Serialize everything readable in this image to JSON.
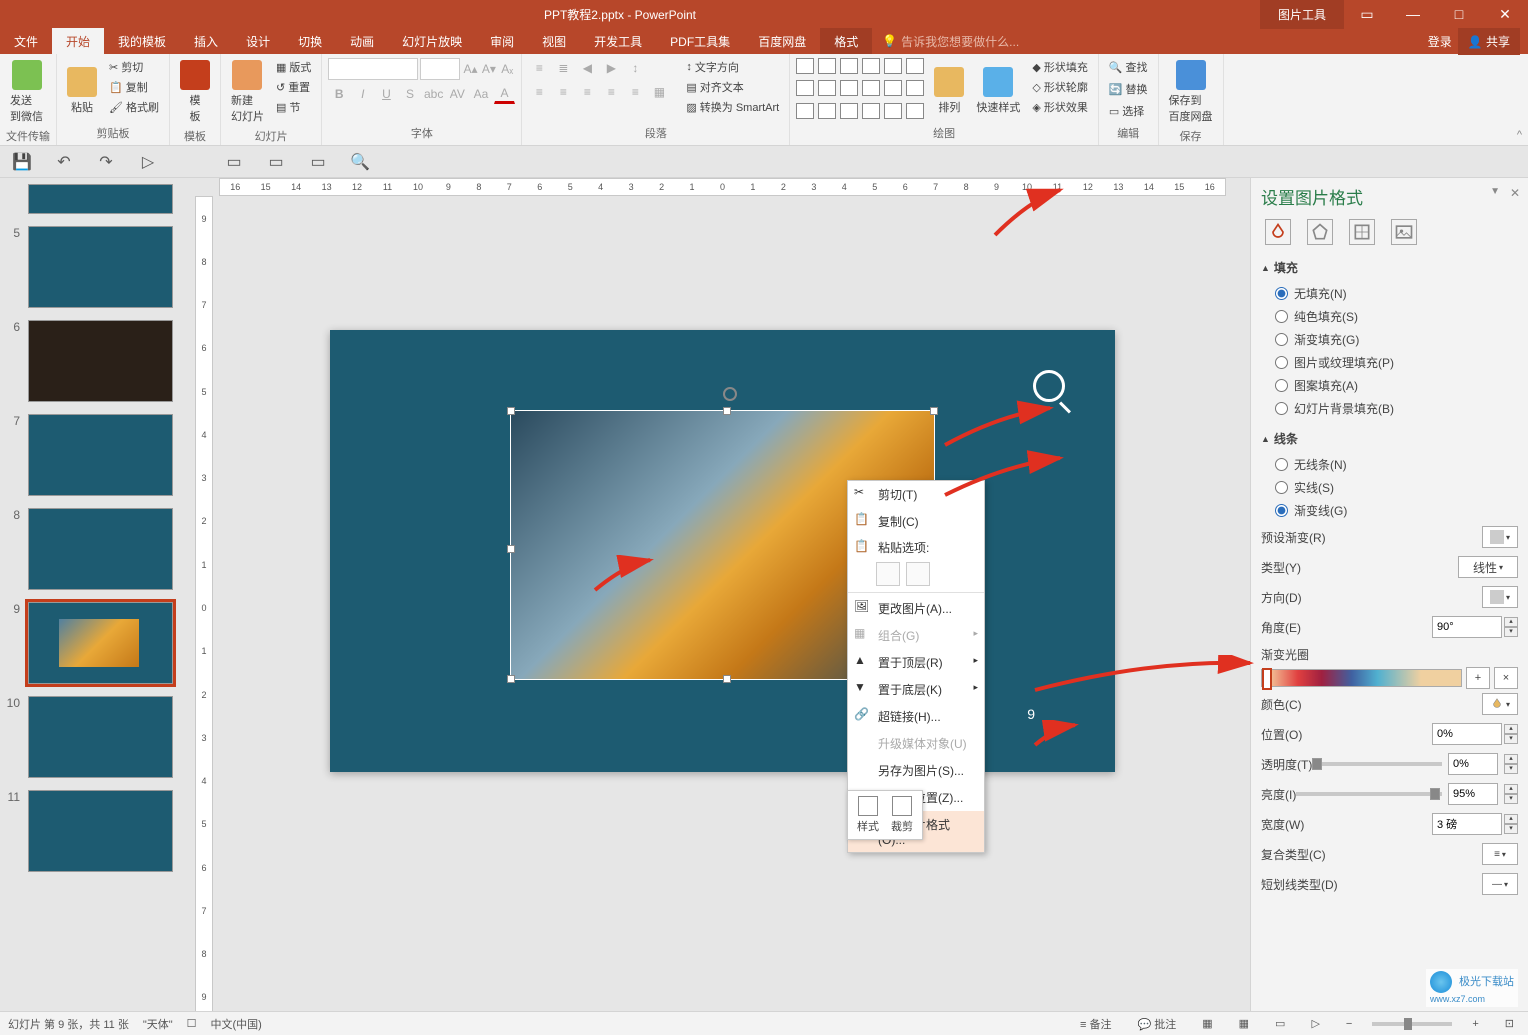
{
  "app": {
    "title": "PPT教程2.pptx - PowerPoint",
    "picture_tools": "图片工具"
  },
  "win": {
    "login": "登录",
    "share": "共享"
  },
  "tabs": {
    "file": "文件",
    "home": "开始",
    "mytpl": "我的模板",
    "insert": "插入",
    "design": "设计",
    "transition": "切换",
    "animation": "动画",
    "slideshow": "幻灯片放映",
    "review": "审阅",
    "view": "视图",
    "developer": "开发工具",
    "pdftools": "PDF工具集",
    "baidu": "百度网盘",
    "format": "格式",
    "tell": "告诉我您想要做什么..."
  },
  "ribbon": {
    "g_file": {
      "label": "文件传输",
      "send": "发送\n到微信"
    },
    "g_clip": {
      "label": "剪贴板",
      "paste": "粘贴",
      "cut": "剪切",
      "copy": "复制",
      "fmt": "格式刷"
    },
    "g_tpl": {
      "label": "模板",
      "tpl": "模\n板"
    },
    "g_slides": {
      "label": "幻灯片",
      "new": "新建\n幻灯片",
      "layout": "版式",
      "reset": "重置",
      "section": "节"
    },
    "g_font": {
      "label": "字体"
    },
    "g_para": {
      "label": "段落",
      "dir": "文字方向",
      "align": "对齐文本",
      "smart": "转换为 SmartArt"
    },
    "g_draw": {
      "label": "绘图",
      "arrange": "排列",
      "quick": "快速样式",
      "fill": "形状填充",
      "outline": "形状轮廓",
      "effects": "形状效果"
    },
    "g_edit": {
      "label": "编辑",
      "find": "查找",
      "replace": "替换",
      "select": "选择"
    },
    "g_save": {
      "label": "保存",
      "save": "保存到\n百度网盘"
    }
  },
  "ruler_ticks": [
    "16",
    "15",
    "14",
    "13",
    "12",
    "11",
    "10",
    "9",
    "8",
    "7",
    "6",
    "5",
    "4",
    "3",
    "2",
    "1",
    "0",
    "1",
    "2",
    "3",
    "4",
    "5",
    "6",
    "7",
    "8",
    "9",
    "10",
    "11",
    "12",
    "13",
    "14",
    "15",
    "16"
  ],
  "vruler": [
    "9",
    "8",
    "7",
    "6",
    "5",
    "4",
    "3",
    "2",
    "1",
    "0",
    "1",
    "2",
    "3",
    "4",
    "5",
    "6",
    "7",
    "8",
    "9"
  ],
  "thumbs": [
    "5",
    "6",
    "7",
    "8",
    "9",
    "10",
    "11"
  ],
  "slide": {
    "pagenum": "9"
  },
  "ctx": {
    "cut": "剪切(T)",
    "copy": "复制(C)",
    "paste_hdr": "粘贴选项:",
    "change": "更改图片(A)...",
    "group": "组合(G)",
    "top": "置于顶层(R)",
    "bottom": "置于底层(K)",
    "link": "超链接(H)...",
    "media": "升级媒体对象(U)",
    "saveas": "另存为图片(S)...",
    "size": "大小和位置(Z)...",
    "fmtpic": "设置图片格式(O)..."
  },
  "mini": {
    "style": "样式",
    "crop": "裁剪"
  },
  "panel": {
    "title": "设置图片格式",
    "fill_hdr": "填充",
    "fill_none": "无填充(N)",
    "fill_solid": "纯色填充(S)",
    "fill_grad": "渐变填充(G)",
    "fill_pic": "图片或纹理填充(P)",
    "fill_pat": "图案填充(A)",
    "fill_bg": "幻灯片背景填充(B)",
    "line_hdr": "线条",
    "line_none": "无线条(N)",
    "line_solid": "实线(S)",
    "line_grad": "渐变线(G)",
    "preset": "预设渐变(R)",
    "type": "类型(Y)",
    "type_val": "线性",
    "direction": "方向(D)",
    "angle": "角度(E)",
    "angle_val": "90°",
    "stops": "渐变光圈",
    "color": "颜色(C)",
    "position": "位置(O)",
    "position_val": "0%",
    "trans": "透明度(T)",
    "trans_val": "0%",
    "bright": "亮度(I)",
    "bright_val": "95%",
    "width": "宽度(W)",
    "width_val": "3 磅",
    "compound": "复合类型(C)",
    "dash": "短划线类型(D)"
  },
  "status": {
    "slide": "幻灯片 第 9 张，共 11 张",
    "font": "\"天体\"",
    "lang": "中文(中国)",
    "notes": "备注",
    "comments": "批注"
  },
  "watermark": {
    "text": "极光下载站",
    "url": "www.xz7.com"
  }
}
